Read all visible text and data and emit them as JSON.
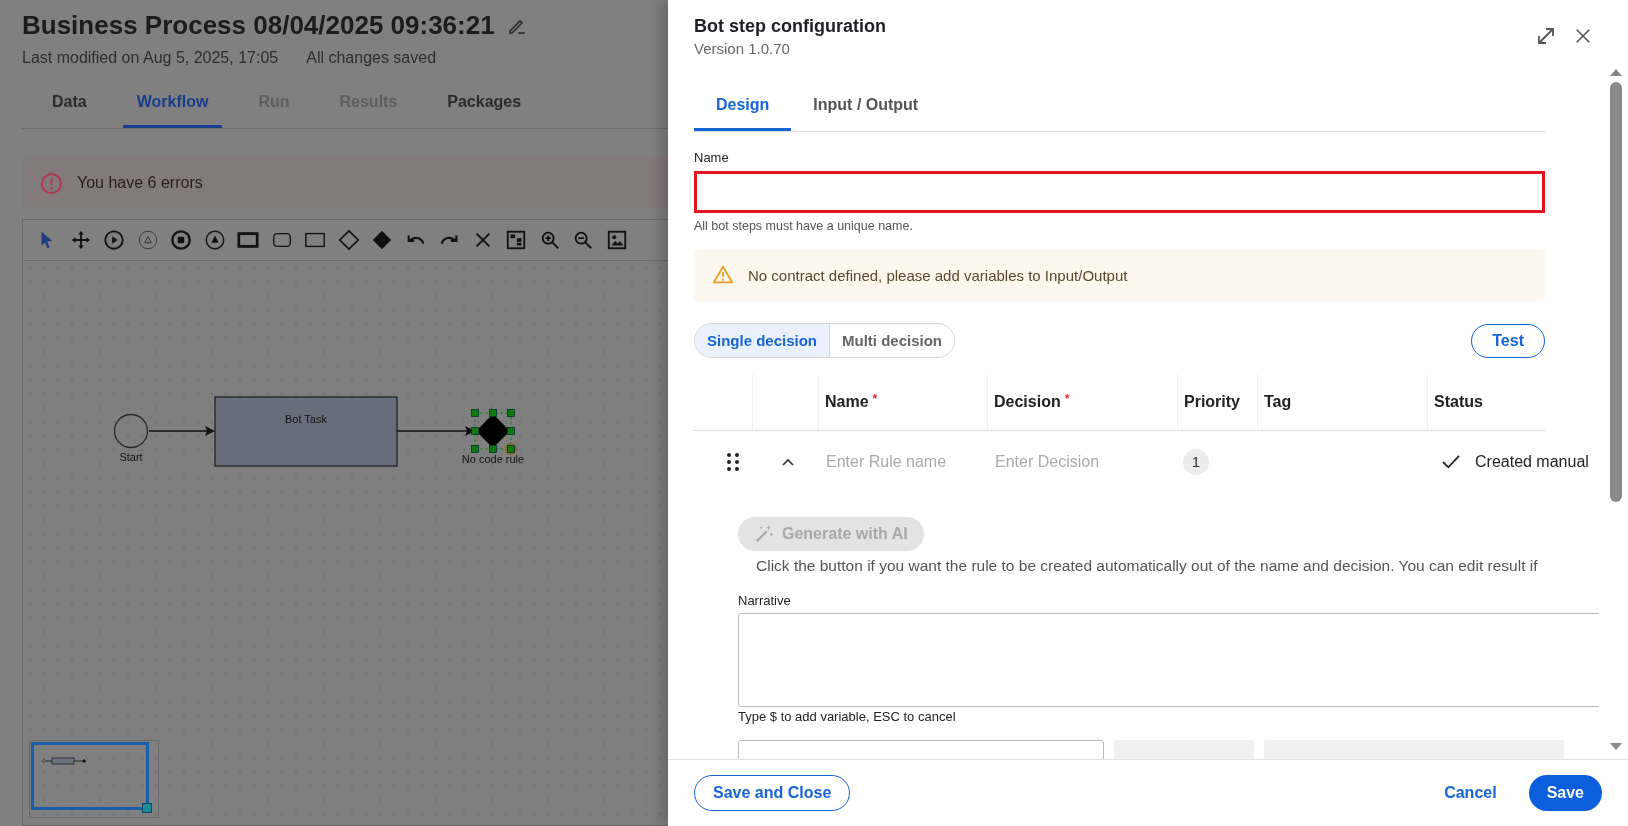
{
  "page": {
    "title": "Business Process 08/04/2025 09:36:21",
    "modified": "Last modified on Aug 5, 2025, 17:05",
    "save_status": "All changes saved"
  },
  "tabs": [
    {
      "label": "Data",
      "selected": false,
      "disabled": false
    },
    {
      "label": "Workflow",
      "selected": true,
      "disabled": false
    },
    {
      "label": "Run",
      "selected": false,
      "disabled": true
    },
    {
      "label": "Results",
      "selected": false,
      "disabled": true
    },
    {
      "label": "Packages",
      "selected": false,
      "disabled": false
    }
  ],
  "alert": {
    "text": "You have 6 errors"
  },
  "diagram": {
    "nodes": [
      {
        "kind": "start",
        "label": "Start",
        "selected": false
      },
      {
        "kind": "task",
        "label": "Bot Task",
        "selected": false
      },
      {
        "kind": "gateway",
        "label": "No code rule",
        "selected": true
      }
    ]
  },
  "panel": {
    "title": "Bot step configuration",
    "version": "Version 1.0.70",
    "tabs": [
      {
        "label": "Design",
        "selected": true
      },
      {
        "label": "Input / Output",
        "selected": false
      }
    ],
    "name_field": {
      "label": "Name",
      "error": true,
      "helper": "All bot steps must have a unique name."
    },
    "warning": "No contract defined, please add variables to Input/Output",
    "mode_toggle": [
      {
        "label": "Single decision",
        "selected": true
      },
      {
        "label": "Multi decision",
        "selected": false
      }
    ],
    "test_button": "Test",
    "rules_table": {
      "columns": [
        {
          "label": "Name",
          "required_mark": "*"
        },
        {
          "label": "Decision",
          "required_mark": "*"
        },
        {
          "label": "Priority"
        },
        {
          "label": "Tag"
        },
        {
          "label": "Status"
        }
      ],
      "rows": [
        {
          "expanded": true,
          "name_placeholder": "Enter Rule name",
          "decision_placeholder": "Enter Decision",
          "priority": "1",
          "status": "Created manual"
        }
      ]
    },
    "generate_button": {
      "label": "Generate with AI",
      "disabled": true
    },
    "generate_hint": "Click the button if you want the rule to be created automatically out of the name and decision. You can edit result if",
    "narrative": {
      "label": "Narrative",
      "helper": "Type $ to add variable, ESC to cancel"
    },
    "footer": {
      "save_and_close": "Save and Close",
      "cancel": "Cancel",
      "save": "Save"
    }
  }
}
